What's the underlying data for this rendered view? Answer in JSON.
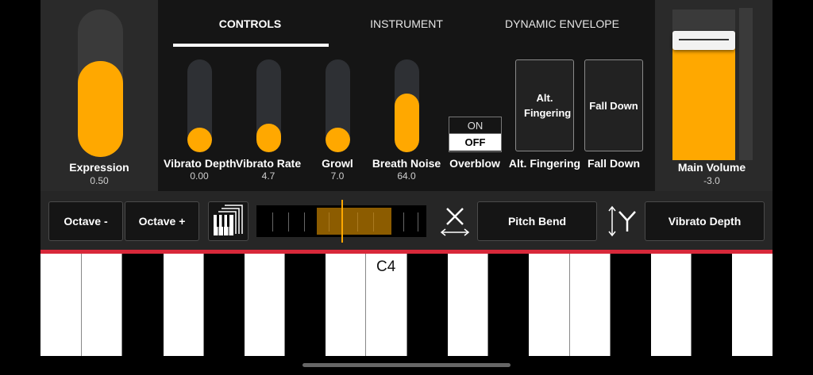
{
  "expression": {
    "label": "Expression",
    "value": "0.50",
    "level": 0.5
  },
  "tabs": [
    {
      "label": "CONTROLS",
      "active": true
    },
    {
      "label": "INSTRUMENT",
      "active": false
    },
    {
      "label": "DYNAMIC ENVELOPE",
      "active": false
    }
  ],
  "sliders": [
    {
      "label": "Vibrato Depth",
      "value": "0.00",
      "level": 0.0
    },
    {
      "label": "Vibrato Rate",
      "value": "4.7",
      "level": 0.06
    },
    {
      "label": "Growl",
      "value": "7.0",
      "level": 0.0
    },
    {
      "label": "Breath Noise",
      "value": "64.0",
      "level": 0.5
    }
  ],
  "overblow": {
    "label": "Overblow",
    "on_label": "ON",
    "off_label": "OFF",
    "state": "OFF"
  },
  "alt_fingering": {
    "button_label": "Alt. Fingering",
    "label": "Alt. Fingering"
  },
  "fall_down": {
    "button_label": "Fall Down",
    "label": "Fall Down"
  },
  "main_volume": {
    "label": "Main Volume",
    "value": "-3.0",
    "level": 0.85
  },
  "control_bar": {
    "octave_minus": "Octave -",
    "octave_plus": "Octave +",
    "x_axis_assign": "Pitch Bend",
    "y_axis_assign": "Vibrato Depth"
  },
  "keyboard": {
    "note_label": "C4"
  },
  "colors": {
    "accent": "#ffa800",
    "divider": "#d8283a",
    "panel": "#2a2a2a",
    "panel_center": "#151515"
  }
}
